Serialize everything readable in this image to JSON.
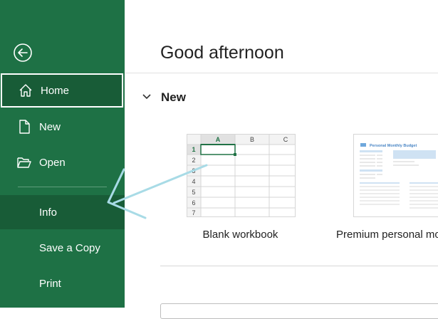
{
  "sidebar": {
    "items": [
      {
        "label": "Home",
        "icon": "home-icon",
        "state": "selected"
      },
      {
        "label": "New",
        "icon": "new-document-icon"
      },
      {
        "label": "Open",
        "icon": "folder-open-icon"
      },
      {
        "label": "Info",
        "state": "hover"
      },
      {
        "label": "Save a Copy"
      },
      {
        "label": "Print"
      }
    ],
    "background": "#1e7145",
    "active_background": "#185c37"
  },
  "main": {
    "greeting": "Good afternoon",
    "new_section": {
      "title": "New",
      "templates": [
        {
          "label": "Blank workbook",
          "columns": [
            "A",
            "B",
            "C"
          ],
          "rows": [
            "1",
            "2",
            "3",
            "4",
            "5",
            "6",
            "7"
          ]
        },
        {
          "label": "Premium personal mo",
          "thumb_title": "Personal Monthly Budget"
        }
      ]
    }
  },
  "annotation": {
    "type": "arrow",
    "color": "#8fd3e0",
    "points_to": "Info"
  }
}
